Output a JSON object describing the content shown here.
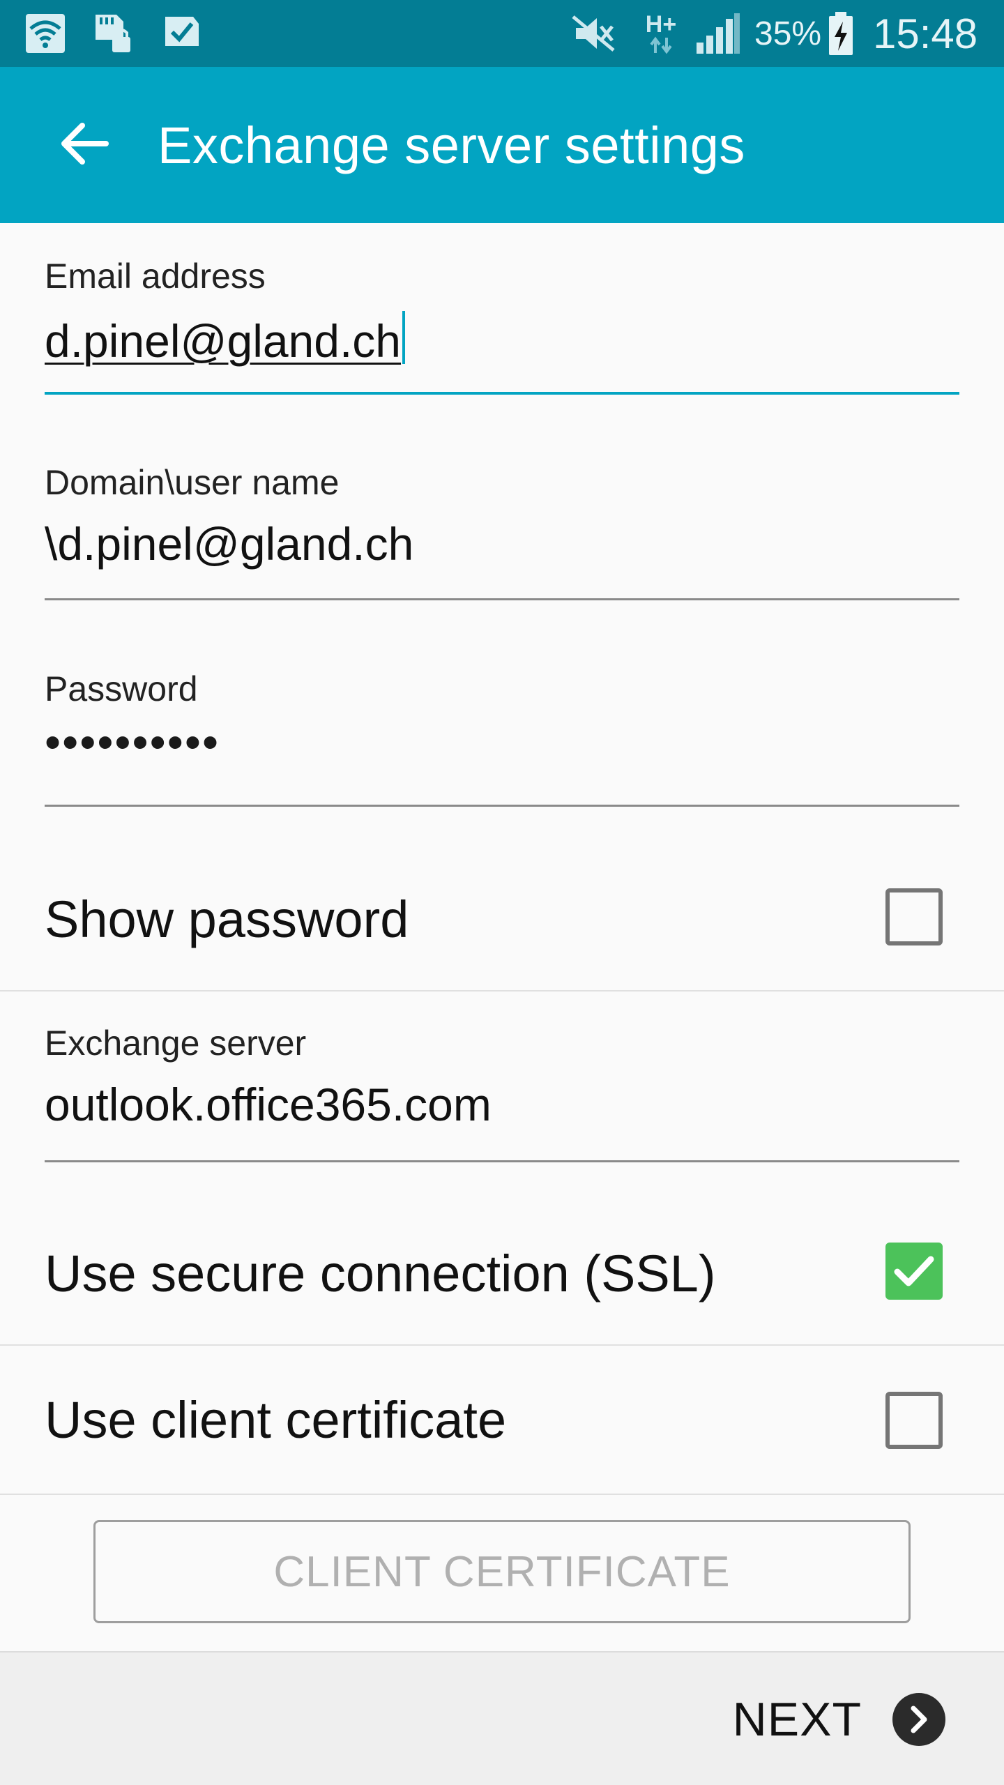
{
  "status_bar": {
    "battery_percent": "35%",
    "time": "15:48",
    "network_label": "H+",
    "icons": [
      "wifi-icon",
      "sd-card-lock-icon",
      "checklist-icon",
      "mute-icon",
      "data-transfer-icon",
      "signal-icon",
      "battery-charging-icon"
    ]
  },
  "app_bar": {
    "title": "Exchange server settings",
    "back_icon": "back-arrow-icon"
  },
  "form": {
    "email": {
      "label": "Email address",
      "value": "d.pinel@gland.ch"
    },
    "domain_user": {
      "label": "Domain\\user name",
      "value": "\\d.pinel@gland.ch"
    },
    "password": {
      "label": "Password",
      "value": "••••••••••"
    },
    "show_password": {
      "label": "Show password",
      "checked": false
    },
    "exchange_server": {
      "label": "Exchange server",
      "value": "outlook.office365.com"
    },
    "ssl": {
      "label": "Use secure connection (SSL)",
      "checked": true
    },
    "client_cert": {
      "label": "Use client certificate",
      "checked": false
    },
    "client_cert_button": "CLIENT CERTIFICATE"
  },
  "footer": {
    "next_label": "NEXT"
  },
  "colors": {
    "status_bar": "#037d94",
    "app_bar": "#02a4c2",
    "checkbox_checked": "#4cc25a",
    "accent": "#02a4c2"
  }
}
